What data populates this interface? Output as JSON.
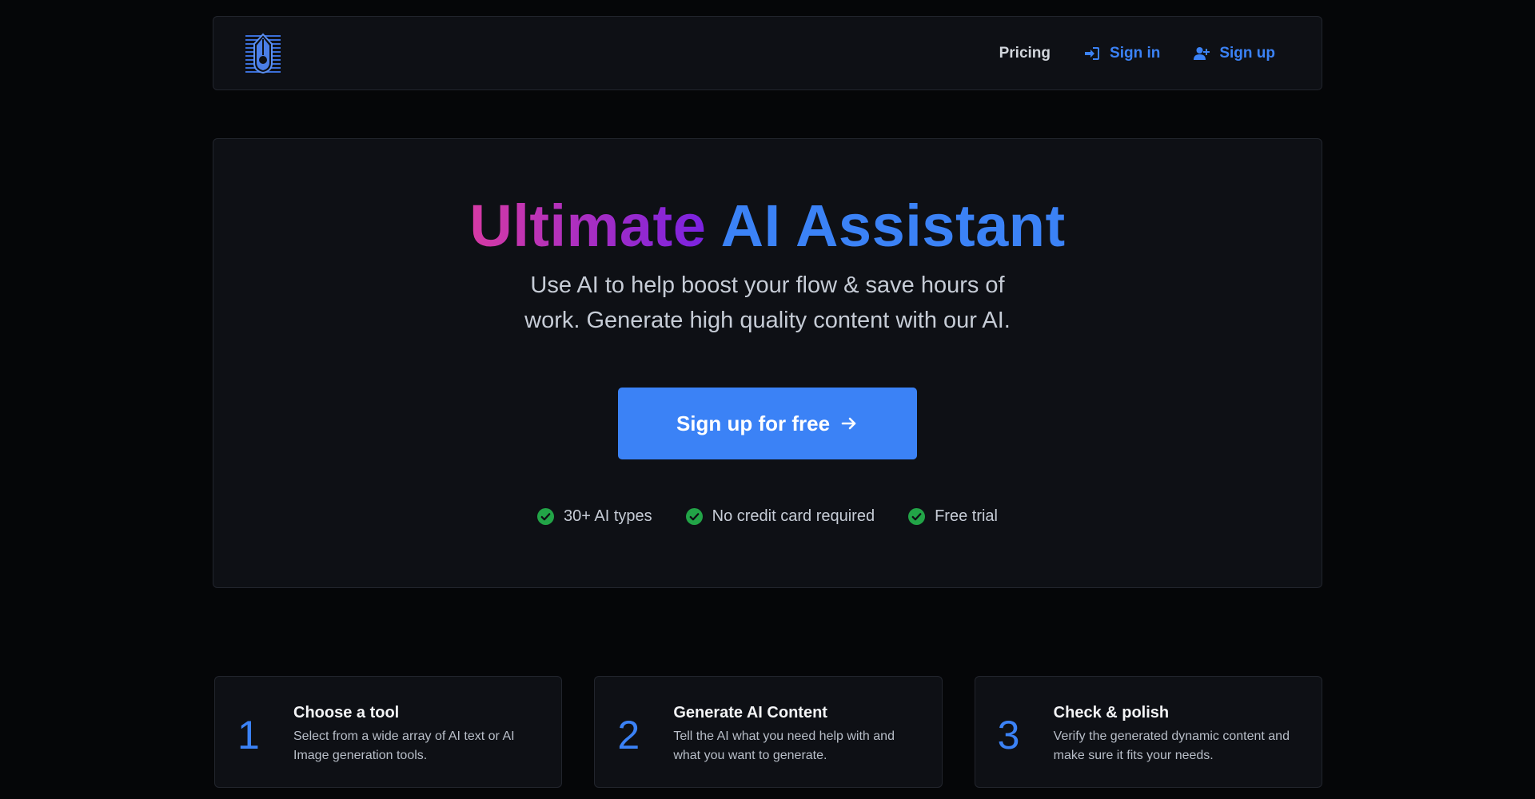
{
  "nav": {
    "pricing": "Pricing",
    "sign_in": "Sign in",
    "sign_up": "Sign up"
  },
  "hero": {
    "title_part1": "Ultimate",
    "title_part2": "AI Assistant",
    "subtitle": "Use AI to help boost your flow & save hours of work. Generate high quality content with our AI.",
    "cta_label": "Sign up for free",
    "features": [
      "30+ AI types",
      "No credit card required",
      "Free trial"
    ]
  },
  "steps": [
    {
      "number": "1",
      "title": "Choose a tool",
      "description": "Select from a wide array of AI text or AI Image generation tools."
    },
    {
      "number": "2",
      "title": "Generate AI Content",
      "description": "Tell the AI what you need help with and what you want to generate."
    },
    {
      "number": "3",
      "title": "Check & polish",
      "description": "Verify the generated dynamic content and make sure it fits your needs."
    }
  ],
  "colors": {
    "accent": "#3b82f6",
    "gradient_start": "#d63aa4",
    "gradient_end": "#7a22e0",
    "check": "#22a447",
    "background": "#050608",
    "panel": "#0e1015"
  },
  "icons": {
    "logo": "pen-nib-logo",
    "sign_in": "sign-in-icon",
    "sign_up": "user-plus-icon",
    "cta": "arrow-right-icon",
    "feature": "check-circle-icon"
  }
}
